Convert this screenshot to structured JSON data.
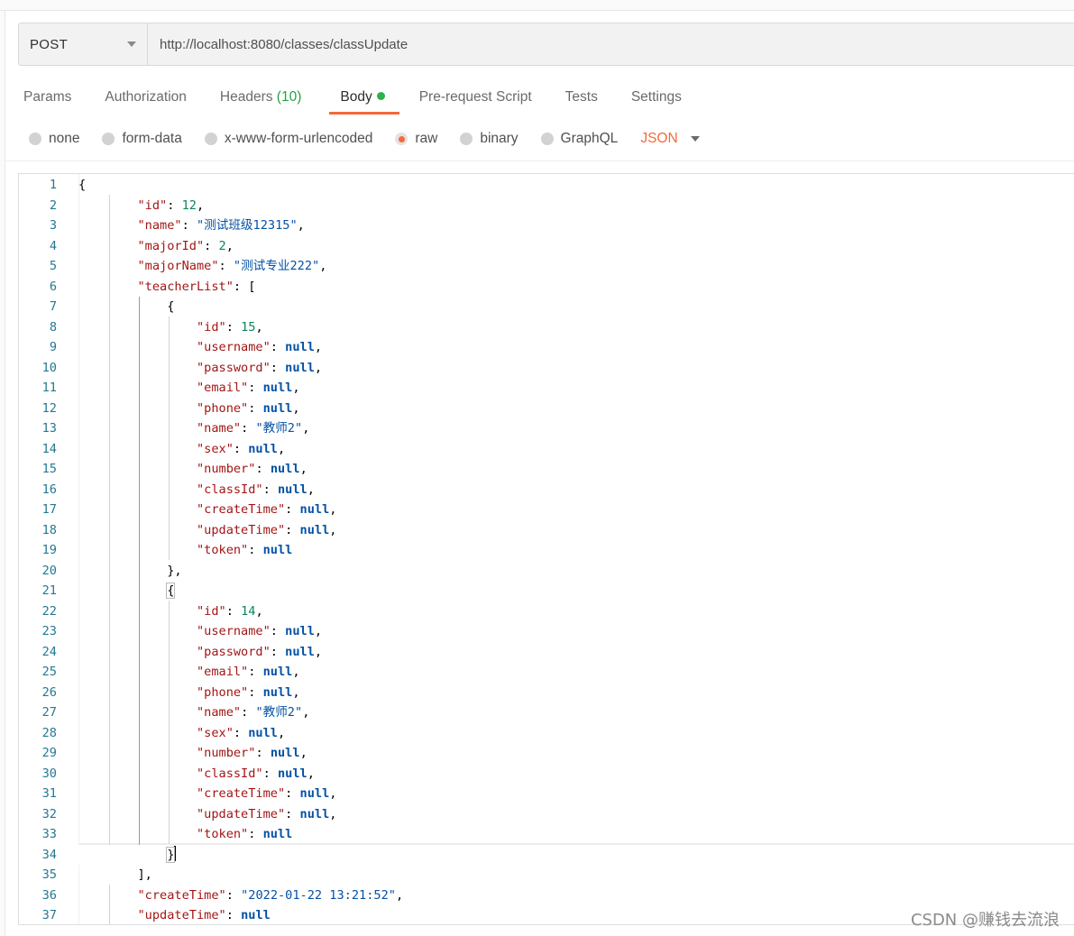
{
  "request": {
    "method": "POST",
    "url": "http://localhost:8080/classes/classUpdate"
  },
  "tabs": {
    "params": "Params",
    "authorization": "Authorization",
    "headers": "Headers",
    "headers_count": "(10)",
    "body": "Body",
    "prerequest": "Pre-request Script",
    "tests": "Tests",
    "settings": "Settings"
  },
  "body_types": {
    "none": "none",
    "form_data": "form-data",
    "urlencoded": "x-www-form-urlencoded",
    "raw": "raw",
    "binary": "binary",
    "graphql": "GraphQL",
    "format": "JSON",
    "selected": "raw"
  },
  "editor": {
    "lines": [
      "1",
      "2",
      "3",
      "4",
      "5",
      "6",
      "7",
      "8",
      "9",
      "10",
      "11",
      "12",
      "13",
      "14",
      "15",
      "16",
      "17",
      "18",
      "19",
      "20",
      "21",
      "22",
      "23",
      "24",
      "25",
      "26",
      "27",
      "28",
      "29",
      "30",
      "31",
      "32",
      "33",
      "34",
      "35",
      "36",
      "37"
    ],
    "class_id": "12",
    "class_name": "\"测试班级12315\"",
    "major_id": "2",
    "major_name": "\"测试专业222\"",
    "created": "\"2022-01-22 13:21:52\"",
    "teachers": [
      {
        "id": "15",
        "name": "\"教师2\""
      },
      {
        "id": "14",
        "name": "\"教师2\""
      }
    ]
  },
  "watermark": "CSDN @赚钱去流浪"
}
